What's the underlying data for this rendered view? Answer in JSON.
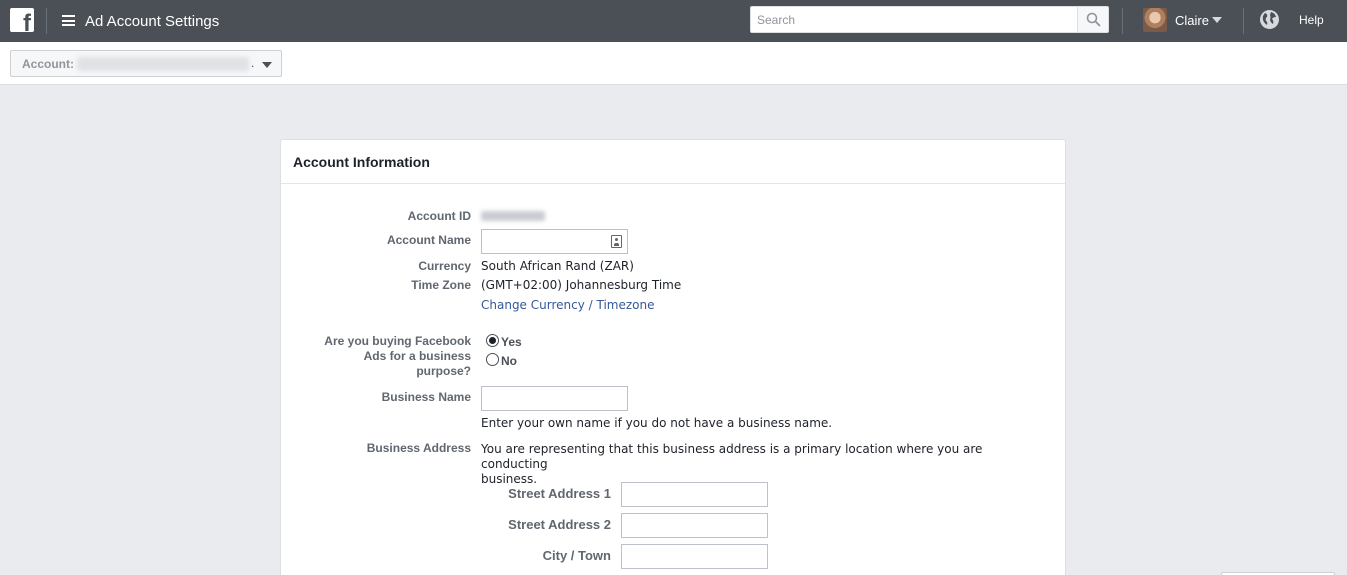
{
  "topbar": {
    "logo": "f",
    "title": "Ad Account Settings",
    "search_placeholder": "Search",
    "user_name": "Claire",
    "help": "Help"
  },
  "subbar": {
    "account_label": "Account:",
    "account_suffix": "."
  },
  "panel": {
    "title": "Account Information",
    "account_id_label": "Account ID",
    "account_name_label": "Account Name",
    "currency_label": "Currency",
    "currency_value": "South African Rand (ZAR)",
    "timezone_label": "Time Zone",
    "timezone_value": "(GMT+02:00) Johannesburg Time",
    "change_link": "Change Currency / Timezone",
    "business_purpose_label_1": "Are you buying Facebook",
    "business_purpose_label_2": "Ads for a business",
    "business_purpose_label_3": "purpose?",
    "option_yes": "Yes",
    "option_no": "No",
    "business_name_label": "Business Name",
    "business_name_hint": "Enter your own name if you do not have a business name.",
    "business_address_label": "Business Address",
    "business_address_note_1": "You are representing that this business address is a primary location where you are conducting",
    "business_address_note_2": "business.",
    "street1_label": "Street Address 1",
    "street2_label": "Street Address 2",
    "city_label": "City / Town"
  },
  "colors": {
    "topbar": "#4b4f56",
    "link": "#365899",
    "background": "#e9ebee"
  }
}
